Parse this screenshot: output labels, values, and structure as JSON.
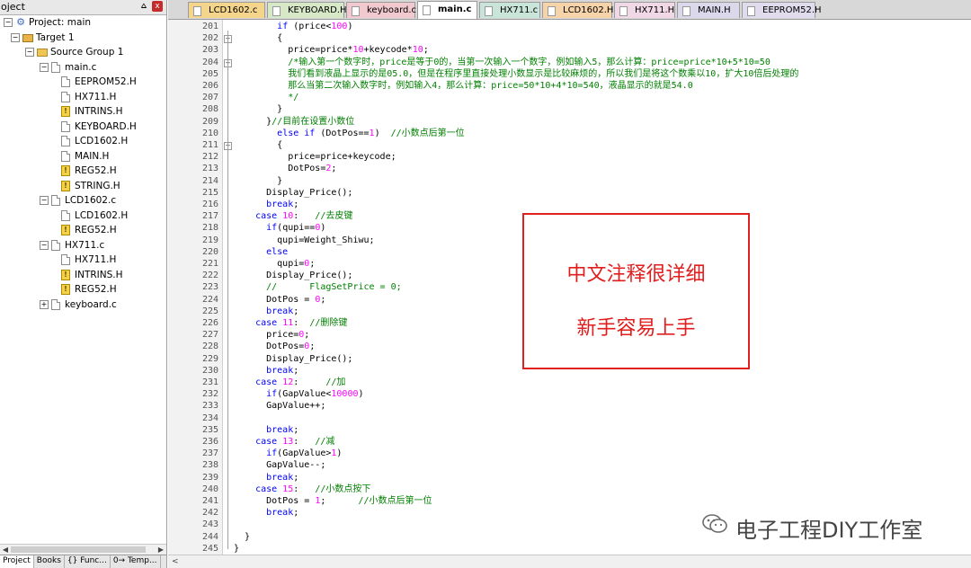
{
  "project_panel": {
    "title": "oject",
    "pin": "⩟",
    "close": "x",
    "tree": [
      {
        "label": "Project: main",
        "kind": "proj",
        "toggle": "−",
        "level": 0
      },
      {
        "label": "Target 1",
        "kind": "target",
        "toggle": "−",
        "level": 1
      },
      {
        "label": "Source Group 1",
        "kind": "folder",
        "toggle": "−",
        "level": 2
      },
      {
        "label": "main.c",
        "kind": "file",
        "toggle": "−",
        "level": 3
      },
      {
        "label": "EEPROM52.H",
        "kind": "file",
        "toggle": "",
        "level": 4
      },
      {
        "label": "HX711.H",
        "kind": "file",
        "toggle": "",
        "level": 4
      },
      {
        "label": "INTRINS.H",
        "kind": "warn",
        "toggle": "",
        "level": 4
      },
      {
        "label": "KEYBOARD.H",
        "kind": "file",
        "toggle": "",
        "level": 4
      },
      {
        "label": "LCD1602.H",
        "kind": "file",
        "toggle": "",
        "level": 4
      },
      {
        "label": "MAIN.H",
        "kind": "file",
        "toggle": "",
        "level": 4
      },
      {
        "label": "REG52.H",
        "kind": "warn",
        "toggle": "",
        "level": 4
      },
      {
        "label": "STRING.H",
        "kind": "warn",
        "toggle": "",
        "level": 4
      },
      {
        "label": "LCD1602.c",
        "kind": "file",
        "toggle": "−",
        "level": 3
      },
      {
        "label": "LCD1602.H",
        "kind": "file",
        "toggle": "",
        "level": 4
      },
      {
        "label": "REG52.H",
        "kind": "warn",
        "toggle": "",
        "level": 4
      },
      {
        "label": "HX711.c",
        "kind": "file",
        "toggle": "−",
        "level": 3
      },
      {
        "label": "HX711.H",
        "kind": "file",
        "toggle": "",
        "level": 4
      },
      {
        "label": "INTRINS.H",
        "kind": "warn",
        "toggle": "",
        "level": 4
      },
      {
        "label": "REG52.H",
        "kind": "warn",
        "toggle": "",
        "level": 4
      },
      {
        "label": "keyboard.c",
        "kind": "file",
        "toggle": "+",
        "level": 3
      }
    ],
    "bottom_tabs": [
      "Project",
      "Books",
      "{} Func...",
      "0→ Temp..."
    ]
  },
  "editor": {
    "tabs": [
      {
        "label": "LCD1602.c",
        "color": "#f4d58b",
        "active": false
      },
      {
        "label": "KEYBOARD.H",
        "color": "#d6e8c5",
        "active": false
      },
      {
        "label": "keyboard.c",
        "color": "#f1c9cf",
        "active": false
      },
      {
        "label": "main.c",
        "color": "#ffffff",
        "active": true
      },
      {
        "label": "HX711.c",
        "color": "#c9e4d8",
        "active": false
      },
      {
        "label": "LCD1602.H",
        "color": "#f6d3a8",
        "active": false
      },
      {
        "label": "HX711.H",
        "color": "#f0d8e6",
        "active": false
      },
      {
        "label": "MAIN.H",
        "color": "#dcd8ec",
        "active": false
      },
      {
        "label": "EEPROM52.H",
        "color": "#e0dcee",
        "active": false
      }
    ],
    "lines": [
      {
        "n": "201",
        "fold": "",
        "segs": [
          [
            "nm",
            "        "
          ],
          [
            "kw",
            "if"
          ],
          [
            "nm",
            " (price<"
          ],
          [
            "num",
            "100"
          ],
          [
            "nm",
            ")"
          ]
        ]
      },
      {
        "n": "202",
        "fold": "−",
        "segs": [
          [
            "nm",
            "        {"
          ]
        ]
      },
      {
        "n": "203",
        "fold": "",
        "segs": [
          [
            "nm",
            "          price=price*"
          ],
          [
            "num",
            "10"
          ],
          [
            "nm",
            "+keycode*"
          ],
          [
            "num",
            "10"
          ],
          [
            "nm",
            ";"
          ]
        ]
      },
      {
        "n": "204",
        "fold": "−",
        "segs": [
          [
            "cm",
            "          /*输入第一个数字时，price是等于0的，当第一次输入一个数字，例如输入5，那么计算：price=price*10+5*10=50"
          ]
        ]
      },
      {
        "n": "205",
        "fold": "",
        "segs": [
          [
            "cm",
            "          我们看到液晶上显示的是05.0，但是在程序里直接处理小数显示是比较麻烦的，所以我们是将这个数乘以10，扩大10倍后处理的"
          ]
        ]
      },
      {
        "n": "206",
        "fold": "",
        "segs": [
          [
            "cm",
            "          那么当第二次输入数字时，例如输入4，那么计算：price=50*10+4*10=540，液晶显示的就是54.0"
          ]
        ]
      },
      {
        "n": "207",
        "fold": "",
        "segs": [
          [
            "cm",
            "          */"
          ]
        ]
      },
      {
        "n": "208",
        "fold": "",
        "segs": [
          [
            "nm",
            "        }"
          ]
        ]
      },
      {
        "n": "209",
        "fold": "",
        "segs": [
          [
            "nm",
            "      }"
          ],
          [
            "cm",
            "//目前在设置小数位"
          ]
        ]
      },
      {
        "n": "210",
        "fold": "",
        "segs": [
          [
            "nm",
            "        "
          ],
          [
            "kw",
            "else if"
          ],
          [
            "nm",
            " (DotPos=="
          ],
          [
            "num",
            "1"
          ],
          [
            "nm",
            ")  "
          ],
          [
            "cm",
            "//小数点后第一位"
          ]
        ]
      },
      {
        "n": "211",
        "fold": "−",
        "segs": [
          [
            "nm",
            "        {"
          ]
        ]
      },
      {
        "n": "212",
        "fold": "",
        "segs": [
          [
            "nm",
            "          price=price+keycode;"
          ]
        ]
      },
      {
        "n": "213",
        "fold": "",
        "segs": [
          [
            "nm",
            "          DotPos="
          ],
          [
            "num",
            "2"
          ],
          [
            "nm",
            ";"
          ]
        ]
      },
      {
        "n": "214",
        "fold": "",
        "segs": [
          [
            "nm",
            "        }"
          ]
        ]
      },
      {
        "n": "215",
        "fold": "",
        "segs": [
          [
            "nm",
            "      Display_Price();"
          ]
        ]
      },
      {
        "n": "216",
        "fold": "",
        "segs": [
          [
            "nm",
            "      "
          ],
          [
            "kw",
            "break"
          ],
          [
            "nm",
            ";"
          ]
        ]
      },
      {
        "n": "217",
        "fold": "",
        "segs": [
          [
            "nm",
            "    "
          ],
          [
            "kw",
            "case"
          ],
          [
            "nm",
            " "
          ],
          [
            "num",
            "10"
          ],
          [
            "nm",
            ":   "
          ],
          [
            "cm",
            "//去皮键"
          ]
        ]
      },
      {
        "n": "218",
        "fold": "",
        "segs": [
          [
            "nm",
            "      "
          ],
          [
            "kw",
            "if"
          ],
          [
            "nm",
            "(qupi=="
          ],
          [
            "num",
            "0"
          ],
          [
            "nm",
            ")"
          ]
        ]
      },
      {
        "n": "219",
        "fold": "",
        "segs": [
          [
            "nm",
            "        qupi=Weight_Shiwu;"
          ]
        ]
      },
      {
        "n": "220",
        "fold": "",
        "segs": [
          [
            "nm",
            "      "
          ],
          [
            "kw",
            "else"
          ]
        ]
      },
      {
        "n": "221",
        "fold": "",
        "segs": [
          [
            "nm",
            "        qupi="
          ],
          [
            "num",
            "0"
          ],
          [
            "nm",
            ";"
          ]
        ]
      },
      {
        "n": "222",
        "fold": "",
        "segs": [
          [
            "nm",
            "      Display_Price();"
          ]
        ]
      },
      {
        "n": "223",
        "fold": "",
        "segs": [
          [
            "cm",
            "      //      FlagSetPrice = 0;"
          ]
        ]
      },
      {
        "n": "224",
        "fold": "",
        "segs": [
          [
            "nm",
            "      DotPos = "
          ],
          [
            "num",
            "0"
          ],
          [
            "nm",
            ";"
          ]
        ]
      },
      {
        "n": "225",
        "fold": "",
        "segs": [
          [
            "nm",
            "      "
          ],
          [
            "kw",
            "break"
          ],
          [
            "nm",
            ";"
          ]
        ]
      },
      {
        "n": "226",
        "fold": "",
        "segs": [
          [
            "nm",
            "    "
          ],
          [
            "kw",
            "case"
          ],
          [
            "nm",
            " "
          ],
          [
            "num",
            "11"
          ],
          [
            "nm",
            ":  "
          ],
          [
            "cm",
            "//删除键"
          ]
        ]
      },
      {
        "n": "227",
        "fold": "",
        "segs": [
          [
            "nm",
            "      price="
          ],
          [
            "num",
            "0"
          ],
          [
            "nm",
            ";"
          ]
        ]
      },
      {
        "n": "228",
        "fold": "",
        "segs": [
          [
            "nm",
            "      DotPos="
          ],
          [
            "num",
            "0"
          ],
          [
            "nm",
            ";"
          ]
        ]
      },
      {
        "n": "229",
        "fold": "",
        "segs": [
          [
            "nm",
            "      Display_Price();"
          ]
        ]
      },
      {
        "n": "230",
        "fold": "",
        "segs": [
          [
            "nm",
            "      "
          ],
          [
            "kw",
            "break"
          ],
          [
            "nm",
            ";"
          ]
        ]
      },
      {
        "n": "231",
        "fold": "",
        "segs": [
          [
            "nm",
            "    "
          ],
          [
            "kw",
            "case"
          ],
          [
            "nm",
            " "
          ],
          [
            "num",
            "12"
          ],
          [
            "nm",
            ":     "
          ],
          [
            "cm",
            "//加"
          ]
        ]
      },
      {
        "n": "232",
        "fold": "",
        "segs": [
          [
            "nm",
            "      "
          ],
          [
            "kw",
            "if"
          ],
          [
            "nm",
            "(GapValue<"
          ],
          [
            "num",
            "10000"
          ],
          [
            "nm",
            ")"
          ]
        ]
      },
      {
        "n": "233",
        "fold": "",
        "segs": [
          [
            "nm",
            "      GapValue++;"
          ]
        ]
      },
      {
        "n": "234",
        "fold": "",
        "segs": [
          [
            "nm",
            ""
          ]
        ]
      },
      {
        "n": "235",
        "fold": "",
        "segs": [
          [
            "nm",
            "      "
          ],
          [
            "kw",
            "break"
          ],
          [
            "nm",
            ";"
          ]
        ]
      },
      {
        "n": "236",
        "fold": "",
        "segs": [
          [
            "nm",
            "    "
          ],
          [
            "kw",
            "case"
          ],
          [
            "nm",
            " "
          ],
          [
            "num",
            "13"
          ],
          [
            "nm",
            ":   "
          ],
          [
            "cm",
            "//减"
          ]
        ]
      },
      {
        "n": "237",
        "fold": "",
        "segs": [
          [
            "nm",
            "      "
          ],
          [
            "kw",
            "if"
          ],
          [
            "nm",
            "(GapValue>"
          ],
          [
            "num",
            "1"
          ],
          [
            "nm",
            ")"
          ]
        ]
      },
      {
        "n": "238",
        "fold": "",
        "segs": [
          [
            "nm",
            "      GapValue--;"
          ]
        ]
      },
      {
        "n": "239",
        "fold": "",
        "segs": [
          [
            "nm",
            "      "
          ],
          [
            "kw",
            "break"
          ],
          [
            "nm",
            ";"
          ]
        ]
      },
      {
        "n": "240",
        "fold": "",
        "segs": [
          [
            "nm",
            "    "
          ],
          [
            "kw",
            "case"
          ],
          [
            "nm",
            " "
          ],
          [
            "num",
            "15"
          ],
          [
            "nm",
            ":   "
          ],
          [
            "cm",
            "//小数点按下"
          ]
        ]
      },
      {
        "n": "241",
        "fold": "",
        "segs": [
          [
            "nm",
            "      DotPos = "
          ],
          [
            "num",
            "1"
          ],
          [
            "nm",
            ";      "
          ],
          [
            "cm",
            "//小数点后第一位"
          ]
        ]
      },
      {
        "n": "242",
        "fold": "",
        "segs": [
          [
            "nm",
            "      "
          ],
          [
            "kw",
            "break"
          ],
          [
            "nm",
            ";"
          ]
        ]
      },
      {
        "n": "243",
        "fold": "",
        "segs": [
          [
            "nm",
            ""
          ]
        ]
      },
      {
        "n": "244",
        "fold": "",
        "segs": [
          [
            "nm",
            "  }"
          ]
        ]
      },
      {
        "n": "245",
        "fold": "",
        "segs": [
          [
            "nm",
            "}"
          ]
        ]
      }
    ]
  },
  "annotation": {
    "line1": "中文注释很详细",
    "line2": "新手容易上手",
    "border_color": "#e02020",
    "text_color": "#e11d1d"
  },
  "watermark": {
    "text": "电子工程DIY工作室",
    "icon": "wechat-icon"
  },
  "statusbar": {
    "arrow": "<"
  }
}
